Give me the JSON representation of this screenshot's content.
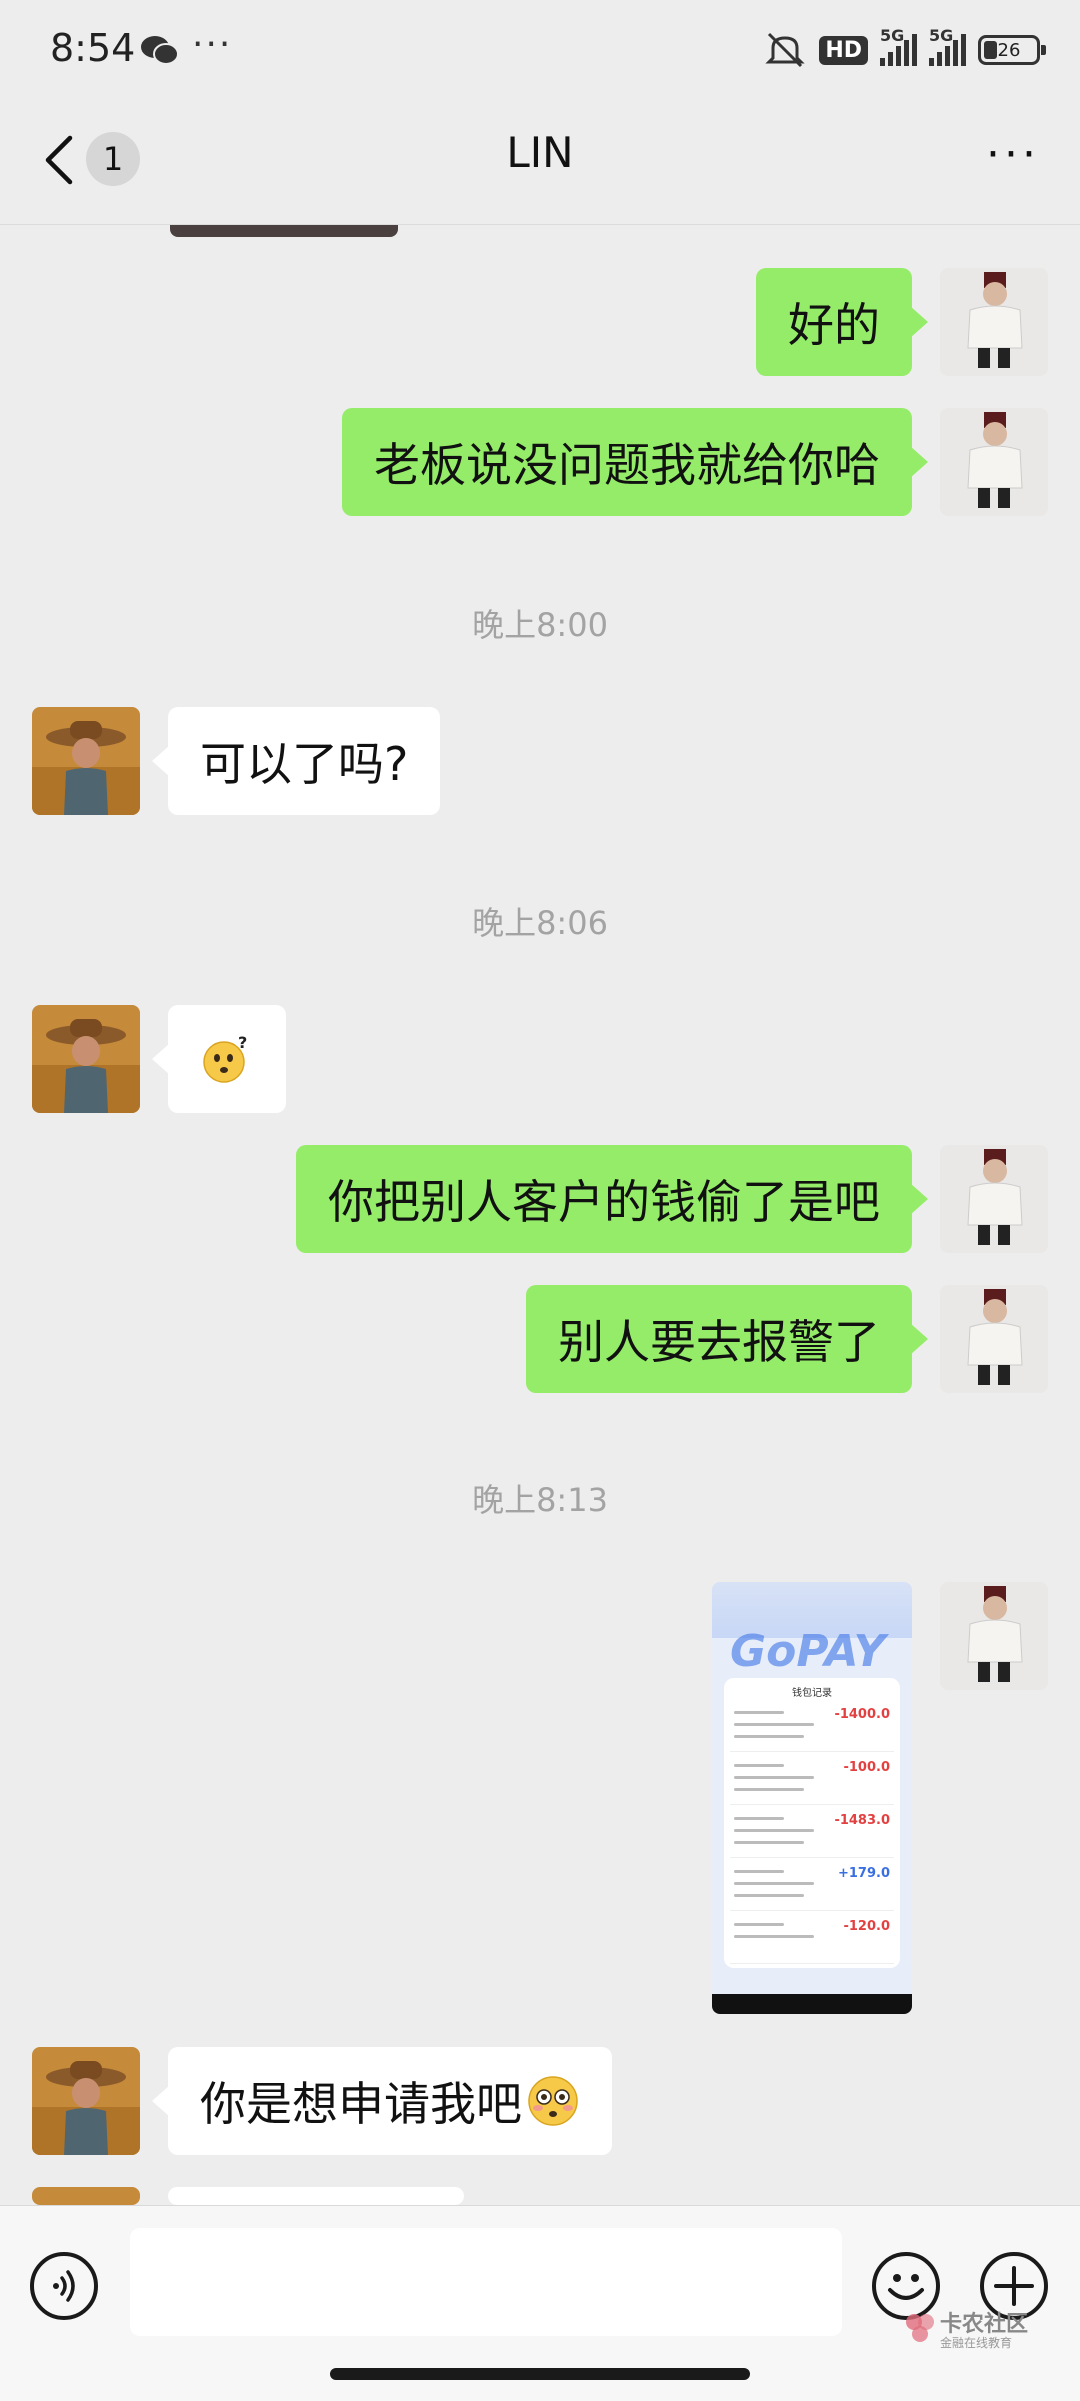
{
  "status_bar": {
    "time": "8:54",
    "dots": "···",
    "hd_label": "HD",
    "signal1_label": "5G",
    "signal2_label": "5G",
    "battery_level": "26",
    "battery_fraction": 0.26
  },
  "nav": {
    "unread_count": "1",
    "title": "LIN",
    "more_label": "···"
  },
  "messages": {
    "m1": "好的",
    "m2": "老板说没问题我就给你哈",
    "t1": "晚上8:00",
    "m3": "可以了吗?",
    "t2": "晚上8:06",
    "t3": "晚上8:13",
    "m5": "你把别人客户的钱偷了是吧",
    "m6": "别人要去报警了",
    "m8": "你是想申请我吧"
  },
  "image_message": {
    "brand": "GoPAY",
    "card_title": "钱包记录",
    "amounts": [
      "-1400.0",
      "-100.0",
      "-1483.0",
      "+179.0",
      "-120.0"
    ]
  },
  "input_bar": {
    "placeholder": ""
  },
  "watermark": {
    "name": "卡农社区",
    "sub": "金融在线教育"
  },
  "colors": {
    "my_bubble": "#95ec69",
    "their_bubble": "#ffffff",
    "background": "#ededed"
  }
}
